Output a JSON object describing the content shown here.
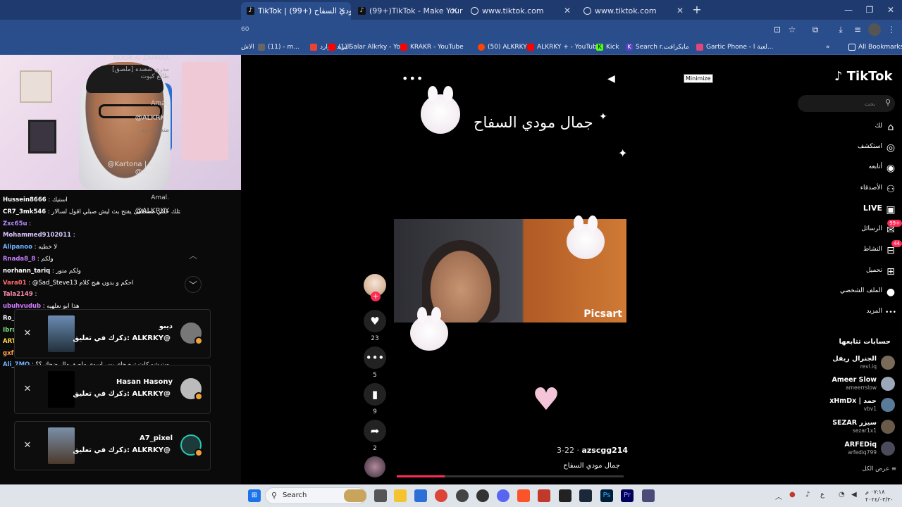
{
  "tabs": [
    {
      "title": "TikTok | جمال مودي السفاح (+99)",
      "active": true
    },
    {
      "title": "(99+)TikTok - Make Your Day",
      "active": false
    },
    {
      "title": "www.tiktok.com",
      "active": false
    },
    {
      "title": "www.tiktok.com",
      "active": false
    }
  ],
  "url_fragment": "60",
  "bookmarks": [
    "الاش",
    "(11) - m...",
    "البريد الوارد",
    "(1) Salar Alkrky - Yo...",
    "KRAKR - YouTube",
    "(50) ALKRKY",
    "ALKRKY + - YouTube",
    "Kick",
    "Search r...",
    "مايكرافت",
    "Gartic Phone - لعبة ا...",
    "All Bookmarks"
  ],
  "chat": [
    {
      "user": "Hussein8666",
      "msg": "استيك",
      "color": "#ffffff"
    },
    {
      "user": "CR7_3mk546",
      "msg": "البارحه من كثلك خلني مصطفى يفتح بث ليش صبلي اقول لسالار",
      "color": "#ffffff"
    },
    {
      "user": "Zxc65u",
      "msg": "",
      "color": "#b58cff"
    },
    {
      "user": "Mohammed9102011",
      "msg": "",
      "color": "#d9c6ff"
    },
    {
      "user": "Alipanoo",
      "msg": "لا خطيه",
      "color": "#6fb2ff"
    },
    {
      "user": "Rnada8_8",
      "msg": "ولكم",
      "color": "#c77dff"
    },
    {
      "user": "norhann_tariq",
      "msg": "ولكم متور",
      "color": "#ffffff"
    },
    {
      "user": "Vara01",
      "msg": "@Sad_Steve13 احكم و بدون هيج كلام",
      "color": "#ff6b6b"
    },
    {
      "user": "Tala2149",
      "msg": "",
      "color": "#ff8fb1"
    },
    {
      "user": "ubuhvudub",
      "msg": "هذا ابو نعلهيه",
      "color": "#d07bff"
    },
    {
      "user": "Ro_ra5",
      "msg": "",
      "color": "#ffffff"
    },
    {
      "user": "Ibrahim_ak",
      "msg": "تقطيع",
      "color": "#7ee07e"
    },
    {
      "user": "ART_Ali",
      "msg": "احبيبيي",
      "color": "#ffd84d"
    },
    {
      "user": "gxfnn",
      "msg": "",
      "color": "#ff9f43"
    },
    {
      "user": "Ali_7MO",
      "msg": "وت شو كلت تره جاي بس اسوي ملصق مال ضحك ؟؟",
      "color": "#6fb2ff"
    }
  ],
  "tt_comments": [
    {
      "name": "NOOR Al ZAHRAA",
      "text": "[ملصق] مدري شعنده طالع كيوت"
    },
    {
      "name": "Amal.",
      "text": "@ALKRKY"
    },
    {
      "name": "Amal.",
      "text": "@Kartona | كارتونه @ALKRKY"
    },
    {
      "name": "Amal.",
      "text": "@ALKRKY"
    }
  ],
  "tt_comment_meta": "منذ 1 د  رد",
  "notifications": [
    {
      "name": "ديبو",
      "sub": "ذكرك في تعليق: ALKRKY@"
    },
    {
      "name": "Hasan Hasony",
      "sub": "ذكرك في تعليق: ALKRKY@"
    },
    {
      "name": "A7_pixel",
      "sub": "ذكرك في تعليق: ALKRKY@"
    }
  ],
  "tiktok": {
    "logo": "TikTok",
    "search_placeholder": "بحث",
    "minimize_tooltip": "Minimize",
    "video_title": "جمال مودي السفاح",
    "watermark": "Picsart",
    "likes": "23",
    "comments": "5",
    "saves": "9",
    "shares": "2",
    "author": "azscgg214",
    "date": "3-22",
    "caption": "جمال مودي السفاح",
    "progress": 0.21
  },
  "nav": [
    {
      "label": "لك",
      "icon": "home-icon"
    },
    {
      "label": "استكشف",
      "icon": "compass-icon"
    },
    {
      "label": "أتابعه",
      "icon": "following-icon"
    },
    {
      "label": "الأصدقاء",
      "icon": "friends-icon"
    },
    {
      "label": "LIVE",
      "icon": "live-icon"
    },
    {
      "label": "الرسائل",
      "icon": "messages-icon",
      "badge": "99+"
    },
    {
      "label": "النشاط",
      "icon": "activity-icon",
      "badge": "44"
    },
    {
      "label": "تحميل",
      "icon": "upload-icon"
    },
    {
      "label": "الملف الشخصي",
      "icon": "profile-icon"
    },
    {
      "label": "المزيد",
      "icon": "more-icon"
    }
  ],
  "following_header": "حسابات تتابعها",
  "following": [
    {
      "name": "الجنرال ريفل",
      "handle": "revl.iq"
    },
    {
      "name": "Ameer Slow",
      "handle": "ameerrslow"
    },
    {
      "name": "xHmDx | حمد",
      "handle": "vbv1"
    },
    {
      "name": "SEZAR سيزر",
      "handle": "sezar1x1"
    },
    {
      "name": "ARFEDiq",
      "handle": "arfediq799"
    }
  ],
  "see_all": "عرض الكل",
  "taskbar": {
    "search": "Search",
    "time": "٠٧:١٨ م",
    "date": "٢٠٢٤/٠٣/٣٠"
  }
}
